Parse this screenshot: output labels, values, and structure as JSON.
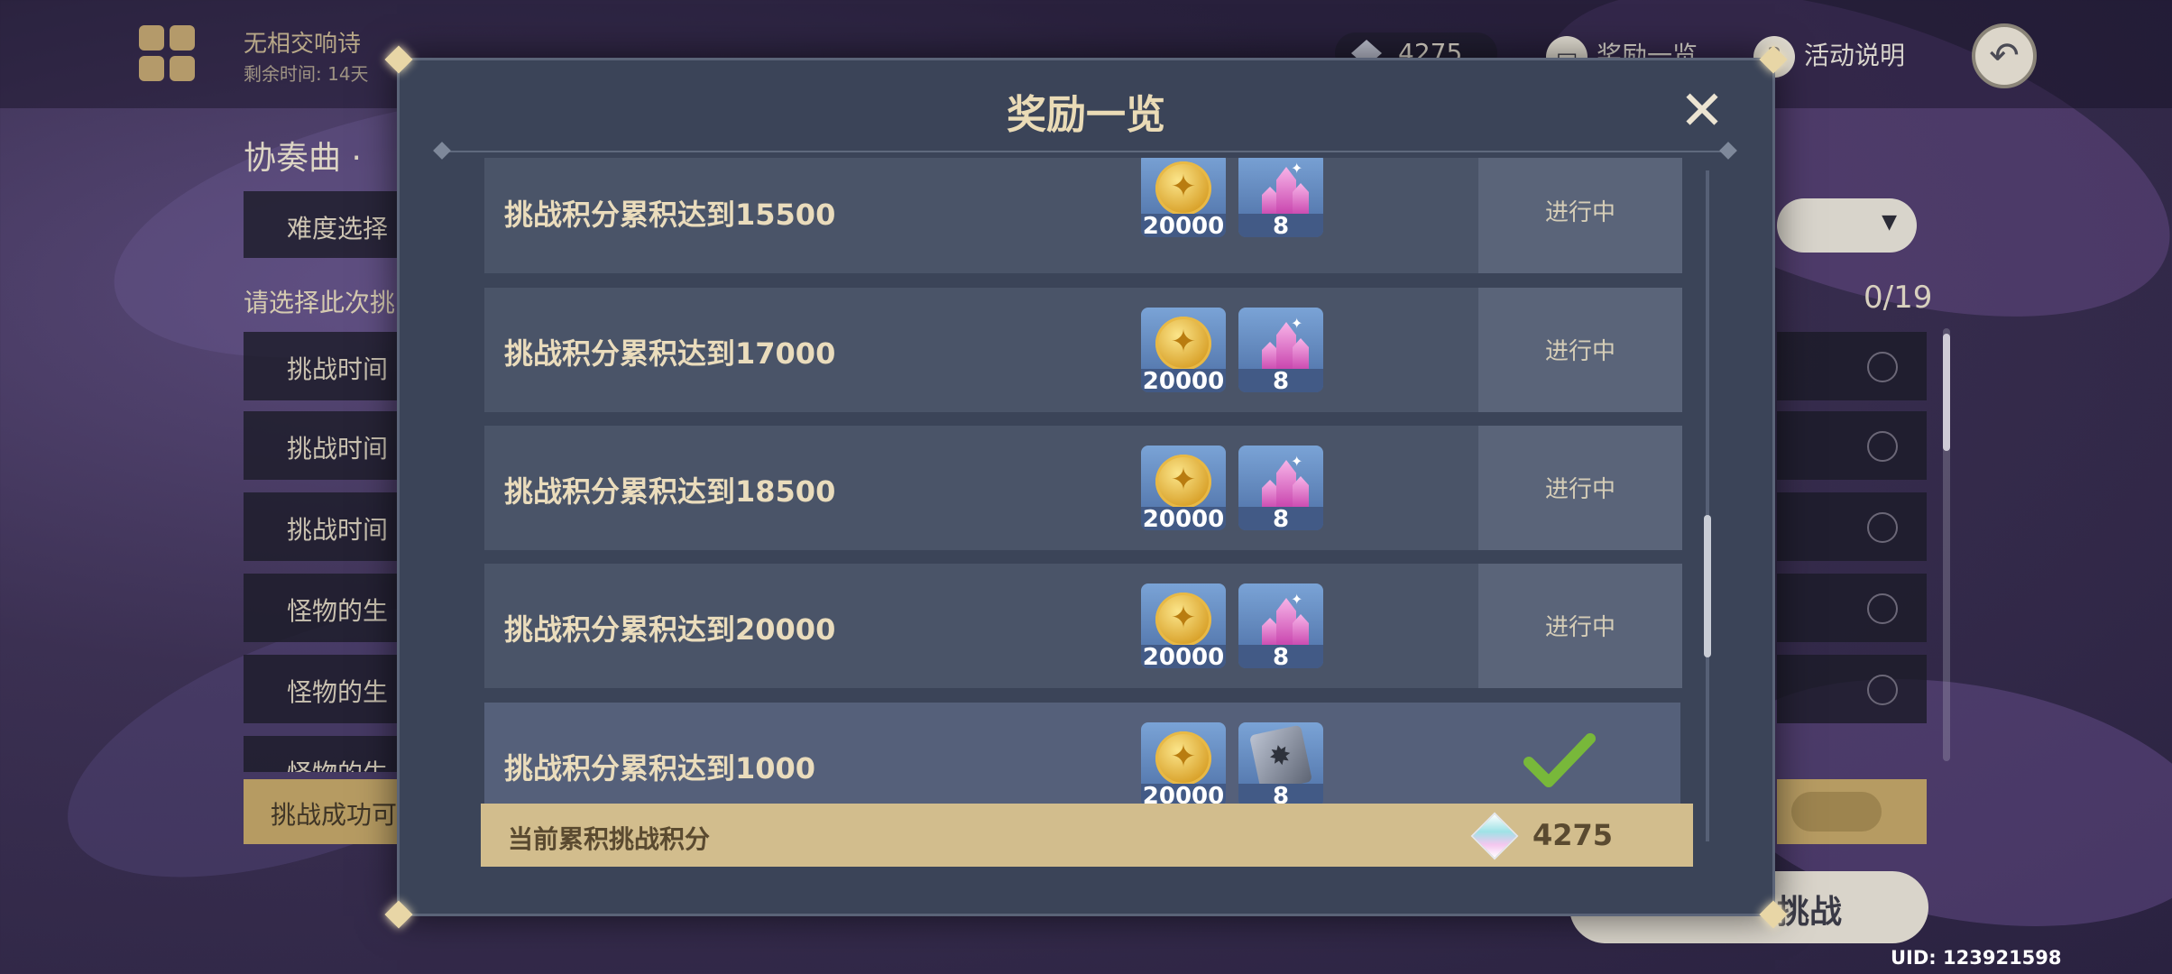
{
  "event": {
    "title": "无相交响诗",
    "remain": "剩余时间: 14天"
  },
  "topbar": {
    "currency_amount": "4275",
    "reward_overview_label": "奖励一览",
    "event_info_label": "活动说明"
  },
  "background_panel": {
    "left_title": "协奏曲 ·",
    "difficulty_label": "难度选择",
    "choose_prompt": "请选择此次挑",
    "rows": [
      "挑战时间",
      "挑战时间",
      "挑战时间",
      "怪物的生",
      "怪物的生",
      "怪物的生"
    ],
    "success_label": "挑战成功可",
    "count": "0/19",
    "start_label": "挑战",
    "uid": "UID: 123921598"
  },
  "modal": {
    "title": "奖励一览",
    "rows": [
      {
        "label": "挑战积分累积达到15500",
        "coin_amount": "20000",
        "item_amount": "8",
        "item": "crystal",
        "status": "进行中",
        "done": false
      },
      {
        "label": "挑战积分累积达到17000",
        "coin_amount": "20000",
        "item_amount": "8",
        "item": "crystal",
        "status": "进行中",
        "done": false
      },
      {
        "label": "挑战积分累积达到18500",
        "coin_amount": "20000",
        "item_amount": "8",
        "item": "crystal",
        "status": "进行中",
        "done": false
      },
      {
        "label": "挑战积分累积达到20000",
        "coin_amount": "20000",
        "item_amount": "8",
        "item": "crystal",
        "status": "进行中",
        "done": false
      },
      {
        "label": "挑战积分累积达到1000",
        "coin_amount": "20000",
        "item_amount": "8",
        "item": "book",
        "status": "",
        "done": true
      }
    ],
    "score_label": "当前累积挑战积分",
    "score_value": "4275"
  },
  "icons": {
    "logo": "event-logo-icon",
    "currency": "primogem-icon",
    "close": "close-icon",
    "back": "back-arrow-icon",
    "check": "checkmark-icon",
    "coin": "mora-coin-icon",
    "crystal": "crystal-icon",
    "book": "book-icon",
    "gem": "score-gem-icon"
  },
  "colors": {
    "modal_bg": "#3b4458",
    "row_bg": "#4a5468",
    "gold_text": "#eadcbc",
    "score_bar": "#d2bd8d",
    "check": "#78b83a"
  }
}
